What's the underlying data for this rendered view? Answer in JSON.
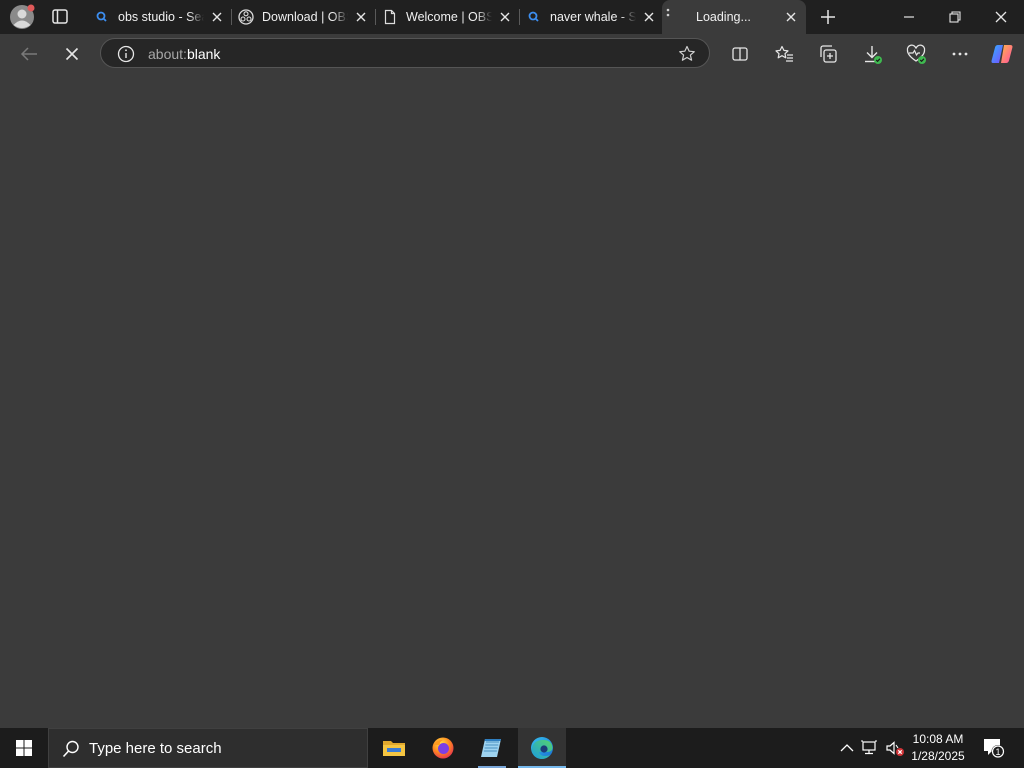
{
  "browser": {
    "tabs": [
      {
        "title": "obs studio - Search",
        "favicon": "search-icon",
        "active": false
      },
      {
        "title": "Download | OBS",
        "favicon": "obs-icon",
        "active": false
      },
      {
        "title": "Welcome | OBS",
        "favicon": "page-icon",
        "active": false
      },
      {
        "title": "naver whale - Search",
        "favicon": "search-icon",
        "active": false
      },
      {
        "title": "Loading...",
        "favicon": "loading-icon",
        "active": true
      }
    ],
    "address": {
      "scheme": "about:",
      "path": "blank"
    }
  },
  "taskbar": {
    "search_placeholder": "Type here to search",
    "apps": [
      "file-explorer-icon",
      "firefox-icon",
      "notepad-icon",
      "edge-icon"
    ],
    "clock": {
      "time": "10:08 AM",
      "date": "1/28/2025"
    },
    "notification_count": "1"
  },
  "colors": {
    "tabstrip_bg": "#202020",
    "content_bg": "#3b3b3b",
    "taskbar_bg": "#1c1c1c",
    "accent": "#76b9ed"
  }
}
